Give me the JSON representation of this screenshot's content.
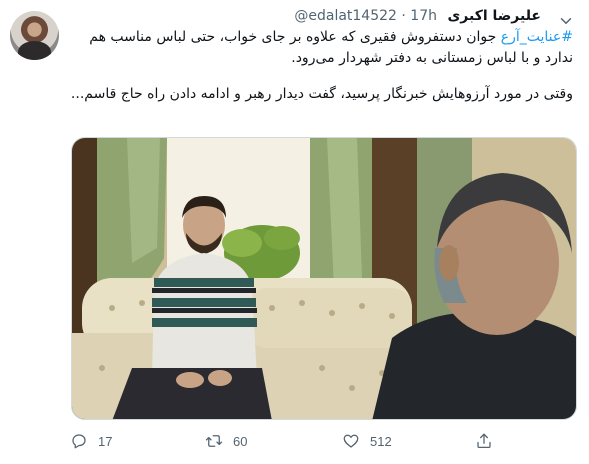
{
  "tweet": {
    "author_name": "علیرضا اکبری",
    "handle": "@edalat14522",
    "separator": "·",
    "time": "17h",
    "hashtag": "#عنایت_آرع",
    "line1_rest": " جوان دستفروش فقیری که علاوه بر جای خواب، حتی لباس مناسب هم ندارد و با لباس زمستانی به دفتر شهردار می‌رود.",
    "paragraph2": "وقتی در مورد آرزوهایش خبرنگار پرسید، گفت دیدار رهبر و ادامه دادن راه حاج قاسم..."
  },
  "actions": {
    "reply_count": "17",
    "retweet_count": "60",
    "like_count": "512"
  },
  "icons": [
    "avatar",
    "chevron-down-icon",
    "reply-icon",
    "retweet-icon",
    "like-icon",
    "share-icon"
  ],
  "colors": {
    "accent": "#1d9bf0",
    "muted": "#536471"
  }
}
